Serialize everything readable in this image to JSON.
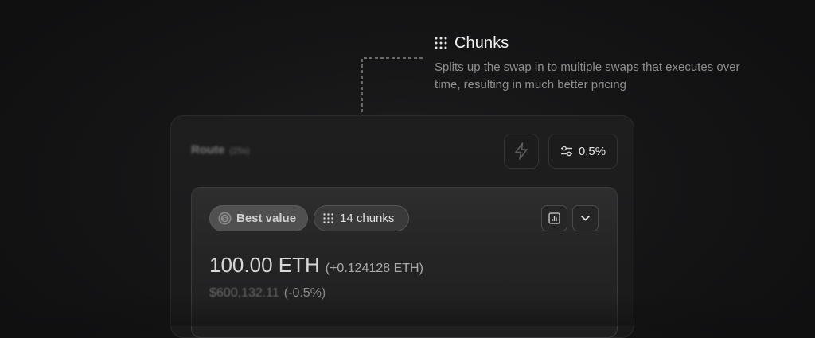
{
  "callout": {
    "title": "Chunks",
    "icon": "dots-grid-icon",
    "description": "Splits up the swap in to multiple swaps that executes over time, resulting in much better pricing"
  },
  "panel": {
    "route_label": "Route",
    "route_time": "(25s)",
    "flash_icon": "lightning-icon",
    "slippage": {
      "icon": "sliders-icon",
      "value": "0.5%"
    }
  },
  "route_card": {
    "badges": [
      {
        "icon": "dollar-coin-icon",
        "label": "Best value"
      },
      {
        "icon": "dots-grid-icon",
        "label": "14 chunks"
      }
    ],
    "actions": [
      {
        "icon": "bar-chart-icon"
      },
      {
        "icon": "chevron-down-icon"
      }
    ],
    "amount": "100.00 ETH",
    "amount_delta": "(+0.124128 ETH)",
    "usd_value": "$600,132.11",
    "usd_change": "(-0.5%)"
  },
  "colors": {
    "background": "#121213",
    "panel": "#1c1c1d",
    "card": "#2a2a2b",
    "text_primary": "#e6e6e6",
    "text_muted": "#8f8f90"
  }
}
